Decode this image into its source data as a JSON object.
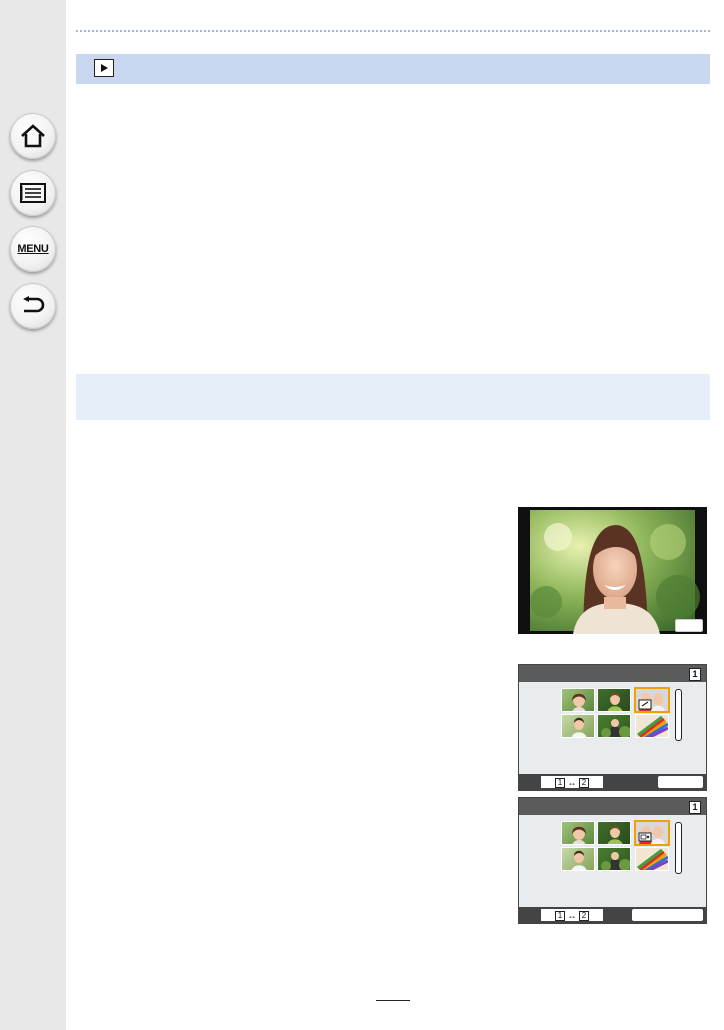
{
  "sidebar": {
    "items": [
      {
        "name": "home",
        "icon": "home-icon"
      },
      {
        "name": "contents",
        "icon": "list-icon"
      },
      {
        "name": "menu",
        "icon": "menu-icon",
        "label": "MENU"
      },
      {
        "name": "back",
        "icon": "back-arrow-icon"
      }
    ]
  },
  "header": {
    "icon": "playback-icon"
  },
  "screens": [
    {
      "page_badge": "1",
      "swap_left": "1",
      "swap_right": "2",
      "highlight_icon": "edit-icon"
    },
    {
      "page_badge": "1",
      "swap_left": "1",
      "swap_right": "2",
      "highlight_icon": "camera-icon"
    }
  ],
  "colors": {
    "header_band": "#c9d7f0",
    "section_band": "#e6eefa",
    "highlight": "#f0a000",
    "sidebar": "#e8e8e8"
  }
}
